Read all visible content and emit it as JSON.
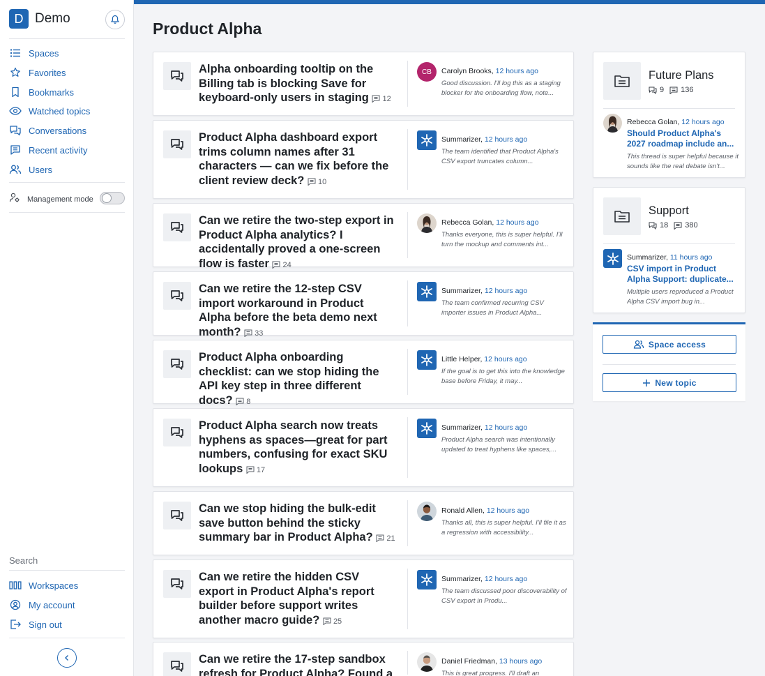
{
  "app": {
    "logo_letter": "D",
    "name": "Demo"
  },
  "colors": {
    "accent": "#1f66b3",
    "avatar_cb": "#b3246b"
  },
  "nav": [
    {
      "label": "Spaces",
      "icon": "list-icon"
    },
    {
      "label": "Favorites",
      "icon": "star-icon"
    },
    {
      "label": "Bookmarks",
      "icon": "bookmark-icon"
    },
    {
      "label": "Watched topics",
      "icon": "eye-icon"
    },
    {
      "label": "Conversations",
      "icon": "conversations-icon"
    },
    {
      "label": "Recent activity",
      "icon": "activity-icon"
    },
    {
      "label": "Users",
      "icon": "users-icon"
    }
  ],
  "management_mode": {
    "label": "Management mode",
    "enabled": false
  },
  "search_label": "Search",
  "bottom_nav": [
    {
      "label": "Workspaces",
      "icon": "workspaces-icon"
    },
    {
      "label": "My account",
      "icon": "account-icon"
    },
    {
      "label": "Sign out",
      "icon": "sign-out-icon"
    }
  ],
  "page": {
    "title": "Product Alpha"
  },
  "topics": [
    {
      "title": "Alpha onboarding tooltip on the Billing tab is blocking Save for keyboard-only users in staging",
      "count": "12",
      "reply": {
        "author": "Carolyn Brooks",
        "time": "12 hours ago",
        "excerpt": "Good discussion. I'll log this as a staging blocker for the onboarding flow, note...",
        "avatar": "initials",
        "initials": "CB"
      }
    },
    {
      "title": "Product Alpha dashboard export trims column names after 31 characters — can we fix before the client review deck?",
      "count": "10",
      "reply": {
        "author": "Summarizer",
        "time": "12 hours ago",
        "excerpt": "The team identified that Product Alpha's CSV export truncates column...",
        "avatar": "bot"
      }
    },
    {
      "title": "Can we retire the two-step export in Product Alpha analytics? I accidentally proved a one-screen flow is faster",
      "count": "24",
      "reply": {
        "author": "Rebecca Golan",
        "time": "12 hours ago",
        "excerpt": "Thanks everyone, this is super helpful. I'll turn the mockup and comments int...",
        "avatar": "photo-woman"
      }
    },
    {
      "title": "Can we retire the 12-step CSV import workaround in Product Alpha before the beta demo next month?",
      "count": "33",
      "reply": {
        "author": "Summarizer",
        "time": "12 hours ago",
        "excerpt": "The team confirmed recurring CSV importer issues in Product Alpha...",
        "avatar": "bot"
      }
    },
    {
      "title": "Product Alpha onboarding checklist: can we stop hiding the API key step in three different docs?",
      "count": "8",
      "reply": {
        "author": "Little Helper",
        "time": "12 hours ago",
        "excerpt": "If the goal is to get this into the knowledge base before Friday, it may...",
        "avatar": "bot"
      }
    },
    {
      "title": "Product Alpha search now treats hyphens as spaces—great for part numbers, confusing for exact SKU lookups",
      "count": "17",
      "reply": {
        "author": "Summarizer",
        "time": "12 hours ago",
        "excerpt": "Product Alpha search was intentionally updated to treat hyphens like spaces,...",
        "avatar": "bot"
      }
    },
    {
      "title": "Can we stop hiding the bulk-edit save button behind the sticky summary bar in Product Alpha?",
      "count": "21",
      "reply": {
        "author": "Ronald Allen",
        "time": "12 hours ago",
        "excerpt": "Thanks all, this is super helpful. I'll file it as a regression with accessibility...",
        "avatar": "photo-man"
      }
    },
    {
      "title": "Can we retire the hidden CSV export in Product Alpha's report builder before support writes another macro guide?",
      "count": "25",
      "reply": {
        "author": "Summarizer",
        "time": "12 hours ago",
        "excerpt": "The team discussed poor discoverability of CSV export in Produ...",
        "avatar": "bot"
      }
    },
    {
      "title": "Can we retire the 17-step sandbox refresh for Product Alpha? Found a",
      "count": "",
      "reply": {
        "author": "Daniel Friedman",
        "time": "13 hours ago",
        "excerpt": "This is great progress. I'll draft an",
        "avatar": "photo-man2"
      }
    }
  ],
  "spaces": [
    {
      "name": "Future Plans",
      "topics": "9",
      "posts": "136",
      "latest": {
        "author": "Rebecca Golan",
        "time": "12 hours ago",
        "title": "Should Product Alpha's 2027 roadmap include an...",
        "excerpt": "This thread is super helpful because it sounds like the real debate isn't...",
        "avatar": "photo-woman"
      }
    },
    {
      "name": "Support",
      "topics": "18",
      "posts": "380",
      "latest": {
        "author": "Summarizer",
        "time": "11 hours ago",
        "title": "CSV import in Product Alpha Support: duplicate...",
        "excerpt": "Multiple users reproduced a Product Alpha CSV import bug in...",
        "avatar": "bot"
      }
    }
  ],
  "actions": {
    "space_access": "Space access",
    "new_topic": "New topic"
  }
}
